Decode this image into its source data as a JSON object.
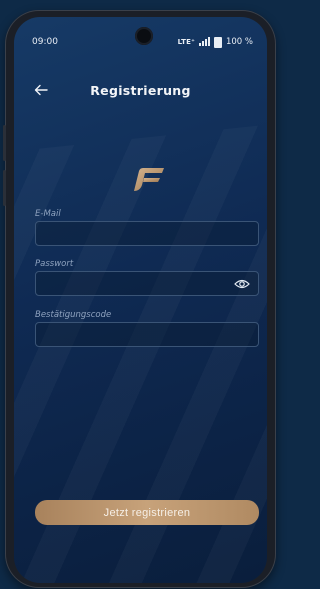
{
  "status_bar": {
    "time": "09:00",
    "network": "LTE⁺",
    "battery": "100 %"
  },
  "header": {
    "back_icon": "arrow-left",
    "title": "Registrierung"
  },
  "logo": {
    "icon": "brand-logo"
  },
  "form": {
    "email_label": "E-Mail",
    "email_value": "",
    "password_label": "Passwort",
    "password_value": "",
    "password_toggle_icon": "eye-icon",
    "code_label": "Bestätigungscode",
    "code_value": ""
  },
  "submit": {
    "label": "Jetzt registrieren"
  },
  "colors": {
    "accent_gold": "#c7a27a",
    "background_navy": "#0f2a53"
  }
}
